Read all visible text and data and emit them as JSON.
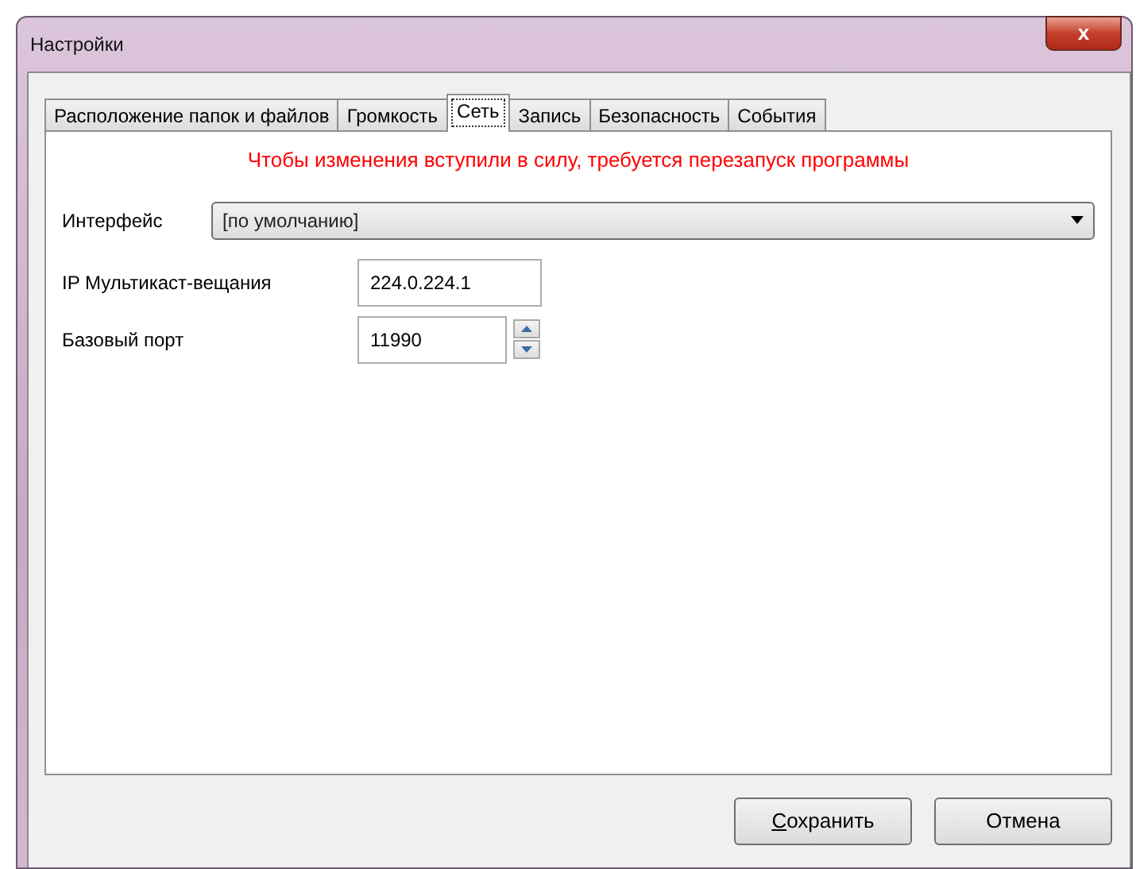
{
  "window": {
    "title": "Настройки",
    "close_label": "x"
  },
  "tabs": [
    {
      "label": "Расположение папок и файлов",
      "selected": false
    },
    {
      "label": "Громкость",
      "selected": false
    },
    {
      "label": "Сеть",
      "selected": true
    },
    {
      "label": "Запись",
      "selected": false
    },
    {
      "label": "Безопасность",
      "selected": false
    },
    {
      "label": "События",
      "selected": false
    }
  ],
  "notice": "Чтобы изменения вступили в силу, требуется перезапуск программы",
  "interface": {
    "label": "Интерфейс",
    "value": "[по умолчанию]"
  },
  "multicast_ip": {
    "label": "IP Мультикаст-вещания",
    "value": "224.0.224.1"
  },
  "base_port": {
    "label": "Базовый порт",
    "value": "11990"
  },
  "buttons": [
    {
      "label": "Сохранить",
      "mnemonic": true
    },
    {
      "label": "Отмена",
      "mnemonic": false
    }
  ]
}
